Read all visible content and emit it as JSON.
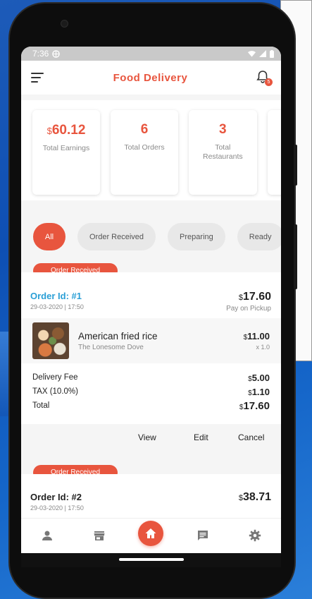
{
  "status_bar": {
    "time": "7:36"
  },
  "app_bar": {
    "title": "Food Delivery",
    "notification_count": "5"
  },
  "stats": [
    {
      "currency": "$",
      "value": "60.12",
      "label": "Total Earnings"
    },
    {
      "currency": "",
      "value": "6",
      "label": "Total Orders"
    },
    {
      "currency": "",
      "value": "3",
      "label": "Total Restaurants"
    }
  ],
  "filters": [
    "All",
    "Order Received",
    "Preparing",
    "Ready"
  ],
  "orders": [
    {
      "status": "Order Received",
      "id": "Order Id: #1",
      "date": "29-03-2020 | 17:50",
      "currency": "$",
      "total": "17.60",
      "payment": "Pay on Pickup",
      "item": {
        "name": "American fried rice",
        "restaurant": "The Lonesome Dove",
        "currency": "$",
        "price": "11.00",
        "qty": "x 1.0"
      },
      "fees": {
        "delivery_label": "Delivery Fee",
        "delivery_currency": "$",
        "delivery_value": "5.00",
        "tax_label": "TAX (10.0%)",
        "tax_currency": "$",
        "tax_value": "1.10",
        "total_label": "Total",
        "total_currency": "$",
        "total_value": "17.60"
      },
      "actions": {
        "view": "View",
        "edit": "Edit",
        "cancel": "Cancel"
      }
    },
    {
      "status": "Order Received",
      "id": "Order Id: #2",
      "date": "29-03-2020 | 17:50",
      "currency": "$",
      "total": "38.71"
    }
  ],
  "bottom_nav": [
    "person-icon",
    "store-icon",
    "home-icon",
    "chat-icon",
    "gear-icon"
  ],
  "colors": {
    "accent": "#e8553e",
    "order_id_blue": "#2a9fd6",
    "status_bar": "#c9c9c9"
  }
}
